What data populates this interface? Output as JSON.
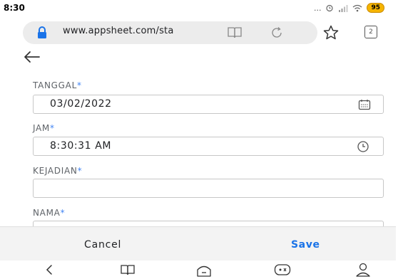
{
  "status_bar": {
    "time": "8:30",
    "extras": "... ",
    "battery": "95"
  },
  "browser": {
    "url": "www.appsheet.com/sta",
    "icons": [
      "lock-icon",
      "reader-mode-icon",
      "reload-icon",
      "bookmark-star-icon",
      "tabs-icon"
    ],
    "tab_count": "2"
  },
  "form": {
    "fields": [
      {
        "label": "TANGGAL",
        "required": "*",
        "value": "03/02/2022",
        "icon": "calendar-icon"
      },
      {
        "label": "JAM",
        "required": "*",
        "value": "8:30:31 AM",
        "icon": "clock-icon"
      },
      {
        "label": "KEJADIAN",
        "required": "*",
        "value": ""
      },
      {
        "label": "NAMA",
        "required": "*",
        "value": ""
      }
    ]
  },
  "actions": {
    "cancel_label": "Cancel",
    "save_label": "Save"
  },
  "nav": {
    "icons": [
      "back-icon",
      "bookmarks-icon",
      "home-icon",
      "tabs-switcher-icon",
      "profile-icon"
    ]
  },
  "colors": {
    "accent": "#1a73e8",
    "required_marker": "#4285f4",
    "battery": "#f5b400"
  }
}
